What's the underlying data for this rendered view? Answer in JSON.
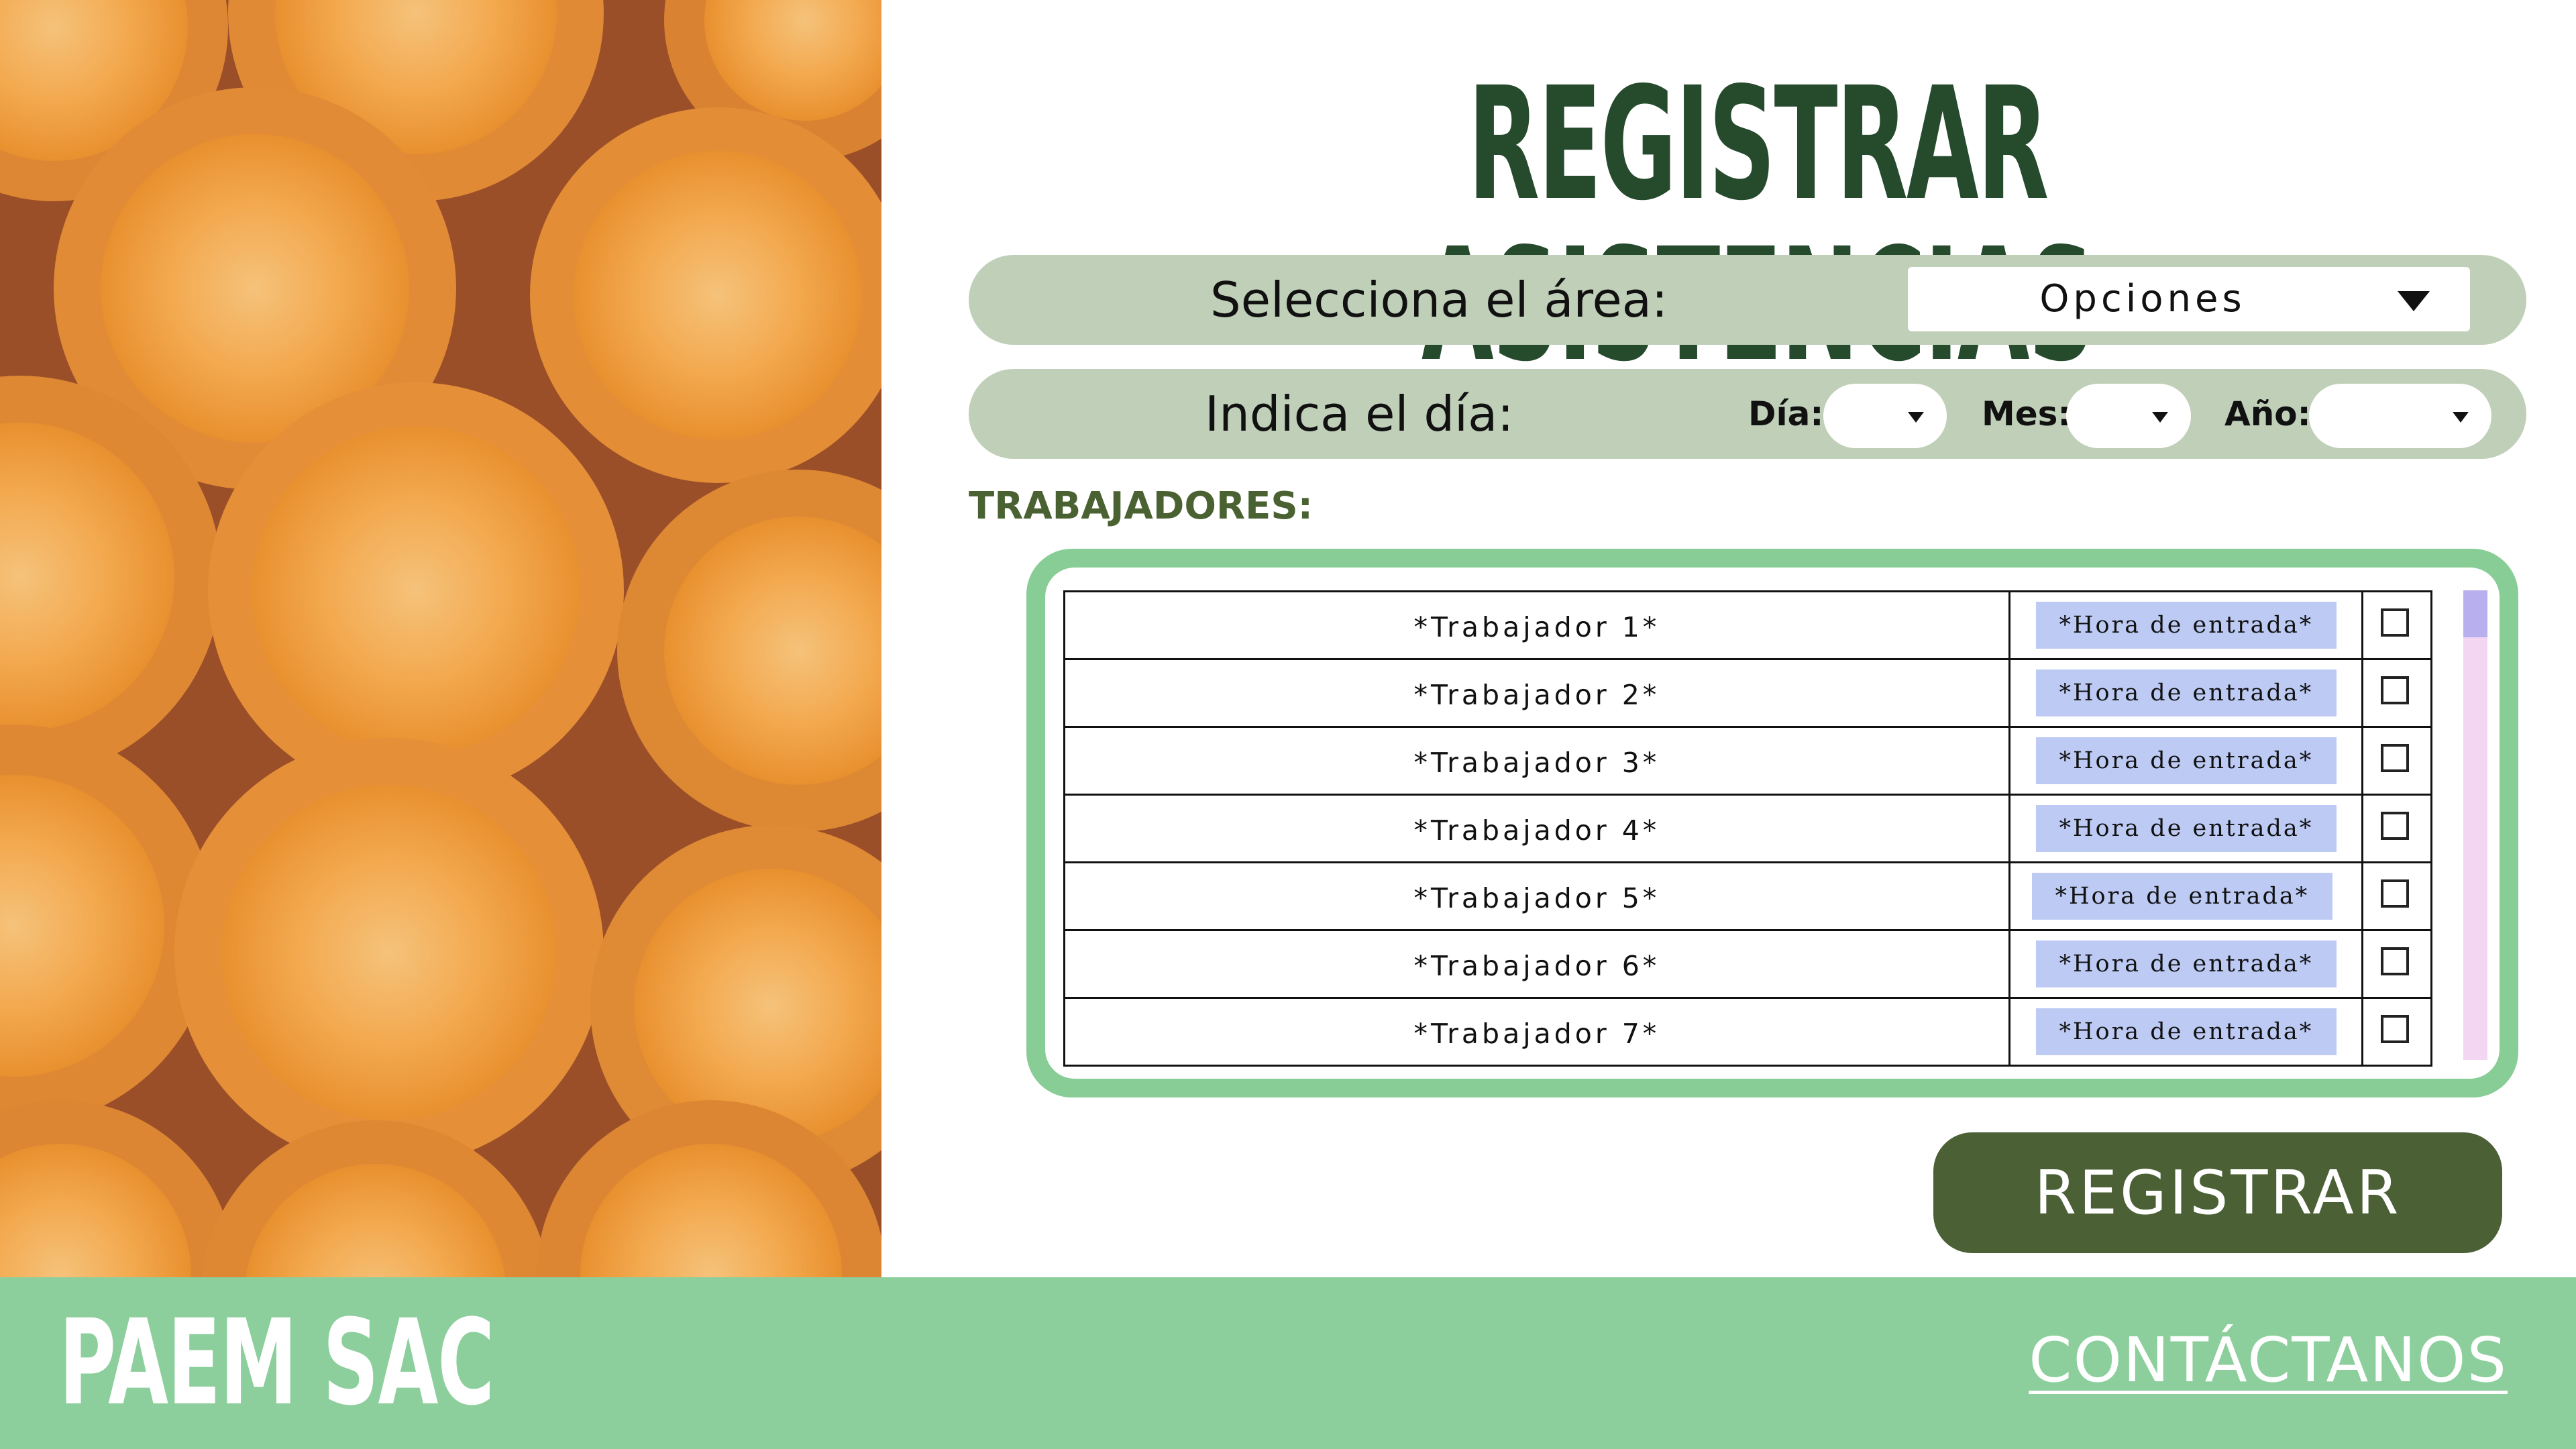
{
  "header": {
    "title": "REGISTRAR ASISTENCIAS"
  },
  "area": {
    "label": "Selecciona el área:",
    "select_value": "Opciones"
  },
  "date": {
    "label": "Indica el día:",
    "day_label": "Día:",
    "month_label": "Mes:",
    "year_label": "Año:"
  },
  "workers": {
    "title": "TRABAJADORES:",
    "rows": [
      {
        "name": "*Trabajador 1*",
        "time": "*Hora de entrada*"
      },
      {
        "name": "*Trabajador 2*",
        "time": "*Hora de entrada*"
      },
      {
        "name": "*Trabajador 3*",
        "time": "*Hora de entrada*"
      },
      {
        "name": "*Trabajador 4*",
        "time": "*Hora de entrada*"
      },
      {
        "name": "*Trabajador 5*",
        "time": "*Hora de entrada*"
      },
      {
        "name": "*Trabajador 6*",
        "time": "*Hora de entrada*"
      },
      {
        "name": "*Trabajador 7*",
        "time": "*Hora de entrada*"
      }
    ]
  },
  "actions": {
    "register_label": "REGISTRAR"
  },
  "footer": {
    "brand": "PAEM SAC",
    "contact_label": "CONTÁCTANOS"
  },
  "colors": {
    "title_green": "#264a2c",
    "pill_bg": "#bfcfb8",
    "frame_green": "#88cc96",
    "time_badge": "#bccaf4",
    "button_green": "#4b6035",
    "footer_green": "#8ccf9c",
    "scroll_track": "#f2d6f2",
    "scroll_thumb": "#b8b0ee"
  },
  "icons": {
    "dropdown": "triangle-down-icon",
    "checkbox": "checkbox-icon"
  }
}
